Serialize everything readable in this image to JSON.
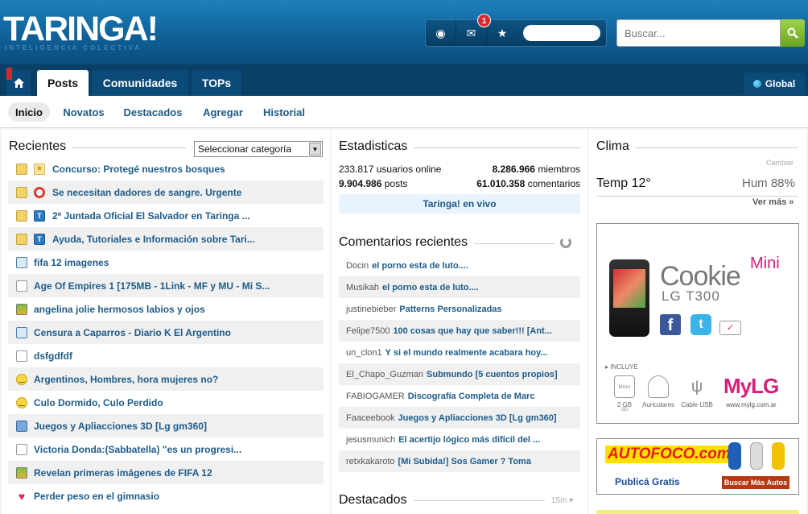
{
  "header": {
    "logo": "TARINGA!",
    "slogan": "INTELIGENCIA COLECTIVA",
    "notification_count": "1",
    "search_placeholder": "Buscar..."
  },
  "nav": {
    "tabs": [
      {
        "label": "Posts"
      },
      {
        "label": "Comunidades"
      },
      {
        "label": "TOPs"
      }
    ],
    "global_label": "Global"
  },
  "subnav": {
    "items": [
      "Inicio",
      "Novatos",
      "Destacados",
      "Agregar",
      "Historial"
    ]
  },
  "recientes": {
    "title": "Recientes",
    "category_select": "Seleccionar categoría",
    "items": [
      {
        "title": "Concurso: Protegé nuestros bosques",
        "icon": "folder",
        "icon2": "star-badge"
      },
      {
        "title": "Se necesitan dadores de sangre. Urgente",
        "icon": "folder",
        "icon2": "lifebuoy"
      },
      {
        "title": "2ª Juntada Oficial El Salvador en Taringa ...",
        "icon": "folder",
        "icon2": "taringa-t"
      },
      {
        "title": "Ayuda, Tutoriales e Información sobre Tari...",
        "icon": "folder",
        "icon2": "taringa-t"
      },
      {
        "title": "fifa 12 imagenes",
        "icon": "book"
      },
      {
        "title": "Age Of Empires 1 [175MB - 1Link - MF y MU - Mi S...",
        "icon": "document"
      },
      {
        "title": "angelina jolie hermosos labios y ojos",
        "icon": "image"
      },
      {
        "title": "Censura a Caparros - Diario K El Argentino",
        "icon": "book"
      },
      {
        "title": "dsfgdfdf",
        "icon": "document"
      },
      {
        "title": "Argentinos, Hombres, hora mujeres no?",
        "icon": "smiley"
      },
      {
        "title": "Culo Dormido, Culo Perdido",
        "icon": "smiley"
      },
      {
        "title": "Juegos y Apliacciones 3D [Lg gm360]",
        "icon": "phone"
      },
      {
        "title": "Victoria Donda:(Sabbatella) \"es un progresi...",
        "icon": "document"
      },
      {
        "title": "Revelan primeras imágenes de FIFA 12",
        "icon": "image"
      },
      {
        "title": "Perder peso en el gimnasio",
        "icon": "heart"
      }
    ]
  },
  "estadisticas": {
    "title": "Estadisticas",
    "users_online_value": "233.817",
    "users_online_label": "usuarios online",
    "members_value": "8.286.966",
    "members_label": "miembros",
    "posts_value": "9.904.986",
    "posts_label": "posts",
    "comments_value": "61.010.358",
    "comments_label": "comentarios",
    "live_label": "Taringa! en vivo"
  },
  "comentarios": {
    "title": "Comentarios recientes",
    "items": [
      {
        "user": "Docin",
        "title": "el porno esta de luto...."
      },
      {
        "user": "Musikah",
        "title": "el porno esta de luto...."
      },
      {
        "user": "justinebieber",
        "title": "Patterns Personalizadas"
      },
      {
        "user": "Felipe7500",
        "title": "100 cosas que hay que saber!!! [Ant..."
      },
      {
        "user": "un_clon1",
        "title": "Y si el mundo realmente acabara hoy..."
      },
      {
        "user": "El_Chapo_Guzman",
        "title": "Submundo [5 cuentos propios]"
      },
      {
        "user": "FABIOGAMER",
        "title": "Discografía Completa de Marc"
      },
      {
        "user": "Faaceebook",
        "title": "Juegos y Apliacciones 3D [Lg gm360]"
      },
      {
        "user": "jesusmunich",
        "title": "El acertijo lógico más difícil del ..."
      },
      {
        "user": "retxkakaroto",
        "title": "[Mi Subida!] Sos Gamer ? Toma"
      }
    ]
  },
  "destacados": {
    "title": "Destacados",
    "time": "15m"
  },
  "clima": {
    "title": "Clima",
    "change_label": "Cambiar",
    "temp": "Temp 12°",
    "humidity": "Hum 88%",
    "more_label": "Ver más »"
  },
  "ad_lg": {
    "brand": "Cookie",
    "brand_suffix": "Mini",
    "model": "LG T300",
    "includes_label": "INCLUYE",
    "accessories": [
      "2 GB",
      "Auriculares",
      "Cable USB"
    ],
    "mylg_logo": "MyLG",
    "mylg_url": "www.mylg.com.ar",
    "memory_card_label": "Micro SD"
  },
  "ad_autofoco": {
    "logo": "AUTOFOCO.com",
    "publish_label": "Publicá Gratis",
    "button_label": "Buscar Más Autos"
  }
}
